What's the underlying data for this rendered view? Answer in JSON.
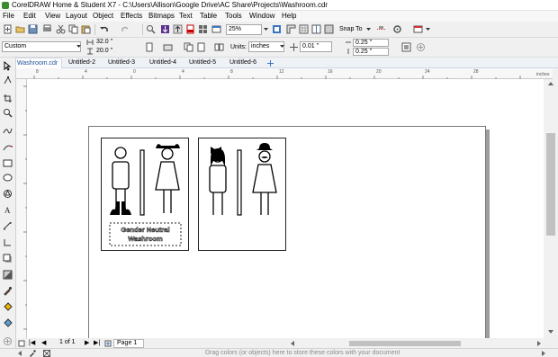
{
  "window": {
    "title": "CorelDRAW Home & Student X7 - C:\\Users\\Allison\\Google Drive\\AC Share\\Projects\\Washroom.cdr"
  },
  "menu": [
    "File",
    "Edit",
    "View",
    "Layout",
    "Object",
    "Effects",
    "Bitmaps",
    "Text",
    "Table",
    "Tools",
    "Window",
    "Help"
  ],
  "standard_toolbar": {
    "zoom": "25%",
    "snap_to": "Snap To"
  },
  "property_bar": {
    "page_size": "Custom",
    "width": "32.0 \"",
    "height": "20.0 \"",
    "units_label": "Units:",
    "units": "inches",
    "nudge": "0.01 \"",
    "dup_x": "0.25 \"",
    "dup_y": "0.25 \""
  },
  "tabs": [
    "Washroom.cdr",
    "Untitled-2",
    "Untitled-3",
    "Untitled-4",
    "Untitled-5",
    "Untitled-6"
  ],
  "ruler": {
    "unit": "inches",
    "h_ticks": [
      "8",
      "4",
      "0",
      "4",
      "8",
      "12",
      "16",
      "20",
      "24",
      "28"
    ]
  },
  "sign1": {
    "label_line1": "Gender Neutral",
    "label_line2": "Washroom"
  },
  "page_nav": {
    "count": "1 of 1",
    "page_tab": "Page 1"
  },
  "status": {
    "hint": "Drag colors (or objects) here to store these colors with your document"
  },
  "colors": {
    "accent": "#3b78c3",
    "canvas": "#ffffff",
    "chrome": "#f0f0f0"
  }
}
